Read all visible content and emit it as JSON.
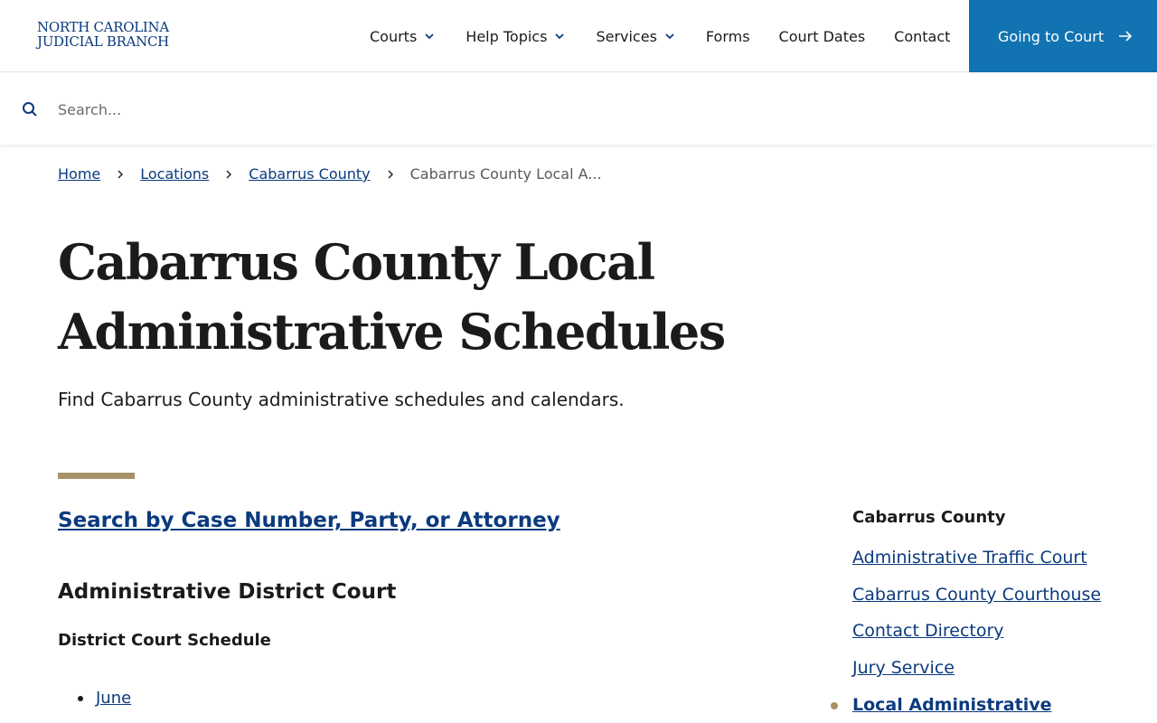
{
  "header": {
    "logo_line1": "NORTH CAROLINA",
    "logo_line2": "JUDICIAL BRANCH",
    "nav": [
      {
        "label": "Courts",
        "dropdown": true
      },
      {
        "label": "Help Topics",
        "dropdown": true
      },
      {
        "label": "Services",
        "dropdown": true
      },
      {
        "label": "Forms",
        "dropdown": false
      },
      {
        "label": "Court Dates",
        "dropdown": false
      },
      {
        "label": "Contact",
        "dropdown": false
      }
    ],
    "cta_label": "Going to Court"
  },
  "search": {
    "placeholder": "Search...",
    "value": ""
  },
  "breadcrumb": {
    "items": [
      "Home",
      "Locations",
      "Cabarrus County"
    ],
    "current": "Cabarrus County Local A..."
  },
  "page": {
    "title": "Cabarrus County Local Administrative Schedules",
    "subtitle": "Find Cabarrus County administrative schedules and calendars."
  },
  "main": {
    "search_link": "Search by Case Number, Party, or Attorney",
    "section_heading": "Administrative District Court",
    "sub_heading": "District Court Schedule",
    "months": [
      "June"
    ]
  },
  "sidebar": {
    "title": "Cabarrus County",
    "items": [
      {
        "label": "Administrative Traffic Court",
        "active": false
      },
      {
        "label": "Cabarrus County Courthouse",
        "active": false
      },
      {
        "label": "Contact Directory",
        "active": false
      },
      {
        "label": "Jury Service",
        "active": false
      },
      {
        "label": "Local Administrative",
        "active": true
      }
    ]
  },
  "colors": {
    "brand_blue": "#0b3a7e",
    "cta_blue": "#1173b1",
    "accent_gold": "#a8916a"
  },
  "icons": {
    "search": "search-icon",
    "chevron": "chevron-down-icon",
    "arrow": "arrow-right-icon",
    "breadcrumb_sep": "chevron-right-icon"
  }
}
